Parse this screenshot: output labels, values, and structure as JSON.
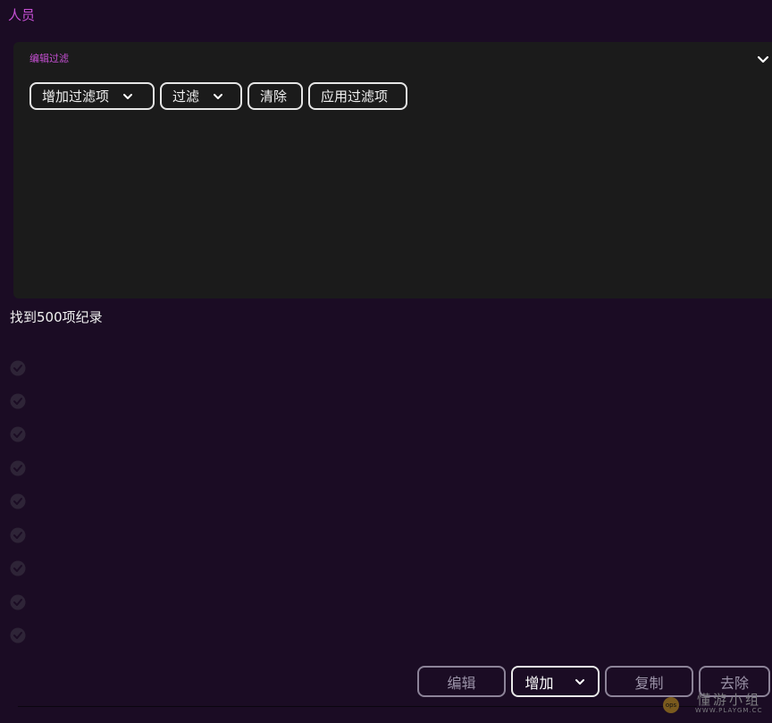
{
  "page": {
    "title": "人员"
  },
  "filter_panel": {
    "title": "编辑过滤",
    "collapse_icon": "chevron-down-icon",
    "buttons": {
      "add_filter": "增加过滤项",
      "filter": "过滤",
      "clear": "清除",
      "apply": "应用过滤项"
    }
  },
  "results": {
    "count_text": "找到500项纪录",
    "row_icon": "check-circle-icon"
  },
  "actions": {
    "edit": "编辑",
    "add": "增加",
    "copy": "复制",
    "remove": "去除"
  },
  "watermark": {
    "logo_text": "ops",
    "title": "懂游小组",
    "url": "WWW.PLAYGM.CC"
  },
  "colors": {
    "background": "#1b0c24",
    "panel": "#1b1b1b",
    "accent": "#c54fd3",
    "text": "#f0f0f0",
    "disabled": "#8c8398"
  }
}
